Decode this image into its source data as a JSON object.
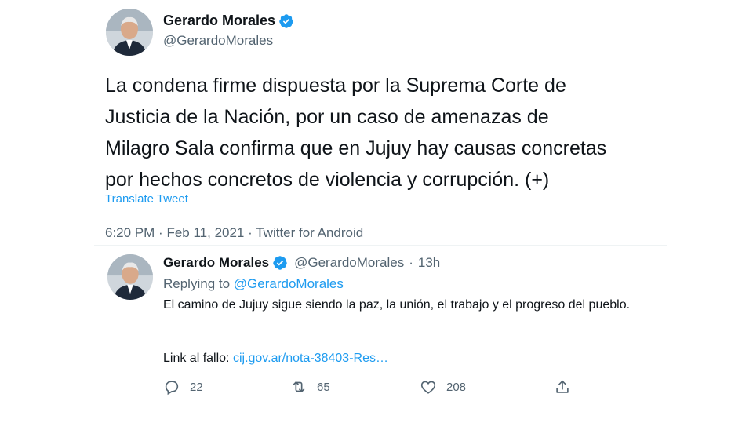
{
  "tweet": {
    "author_name": "Gerardo Morales",
    "handle": "@GerardoMorales",
    "text": "La condena firme dispuesta por la Suprema Corte de\nJusticia de la Nación, por un caso de amenazas de\nMilagro Sala confirma que en Jujuy hay causas concretas\npor hechos concretos de violencia y corrupción. (+)",
    "translate_label": "Translate Tweet",
    "time": "6:20 PM",
    "date": "Feb 11, 2021",
    "source": "Twitter for Android",
    "separator": "·"
  },
  "reply": {
    "author_name": "Gerardo Morales",
    "handle": "@GerardoMorales",
    "separator": "·",
    "time_ago": "13h",
    "replying_prefix": "Replying to",
    "replying_to": "@GerardoMorales",
    "body": "El camino de Jujuy sigue siendo la paz, la unión, el trabajo y el progreso del pueblo.",
    "link_prefix": "Link al fallo:",
    "link_text": "cij.gov.ar/nota-38403-Res…",
    "reply_count": "22",
    "retweet_count": "65",
    "like_count": "208"
  },
  "colors": {
    "accent": "#1d9bf0",
    "secondary_text": "#536471",
    "primary_text": "#0f1419",
    "verified": "#1d9bf0"
  },
  "icons": [
    "verified-badge-icon",
    "reply-icon",
    "retweet-icon",
    "like-icon",
    "share-icon"
  ]
}
